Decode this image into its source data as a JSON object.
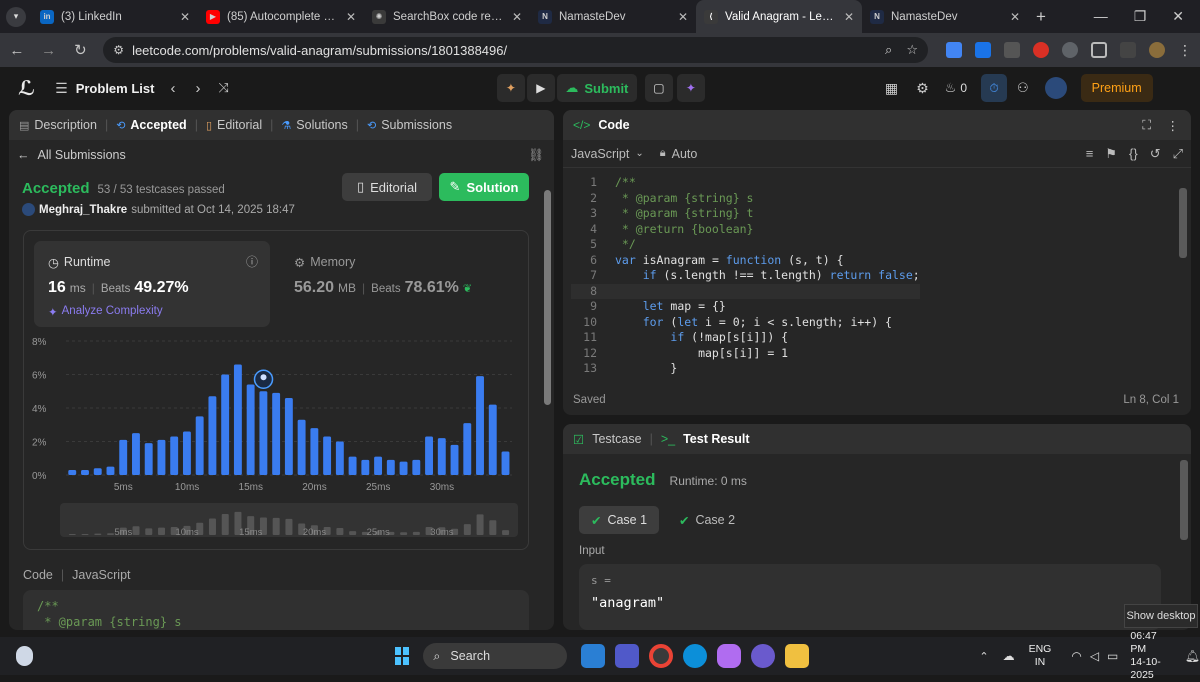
{
  "browser": {
    "tabs": [
      {
        "title": "(3) LinkedIn",
        "icon": "linkedin-icon",
        "color": "#0a66c2",
        "glyph": "in"
      },
      {
        "title": "(85) Autocomplete Search",
        "icon": "youtube-icon",
        "color": "#ff0000",
        "glyph": "▶"
      },
      {
        "title": "SearchBox code review",
        "icon": "chatgpt-icon",
        "color": "#3a3a3a",
        "glyph": "✺"
      },
      {
        "title": "NamasteDev",
        "icon": "namastedev-icon",
        "color": "#1f2a44",
        "glyph": "N"
      },
      {
        "title": "Valid Anagram - LeetCode",
        "icon": "leetcode-icon",
        "color": "#3a3a3a",
        "glyph": "⟨"
      },
      {
        "title": "NamasteDev",
        "icon": "namastedev-icon",
        "color": "#1f2a44",
        "glyph": "N"
      }
    ],
    "active_tab": 4,
    "new_tab": "+",
    "url": "leetcode.com/problems/valid-anagram/submissions/1801388496/"
  },
  "leetcode": {
    "problem_list": "Problem List",
    "submit_label": "Submit",
    "streak_count": "0",
    "premium_label": "Premium"
  },
  "left_panel": {
    "tabs": [
      "Description",
      "Accepted",
      "Editorial",
      "Solutions",
      "Submissions"
    ],
    "active_tab": "Accepted",
    "all_submissions": "All Submissions",
    "status": "Accepted",
    "testcases": "53 / 53 testcases passed",
    "user": "Meghraj_Thakre",
    "submitted_at": "submitted at Oct 14, 2025 18:47",
    "editorial_btn": "Editorial",
    "solution_btn": "Solution",
    "runtime_label": "Runtime",
    "runtime_value": "16",
    "runtime_unit": "ms",
    "runtime_beats_label": "Beats",
    "runtime_beats": "49.27%",
    "analyze": "Analyze Complexity",
    "memory_label": "Memory",
    "memory_value": "56.20",
    "memory_unit": "MB",
    "memory_beats_label": "Beats",
    "memory_beats": "78.61%",
    "code_label": "Code",
    "code_lang": "JavaScript",
    "code_preview": [
      "/**",
      " * @param {string} s"
    ]
  },
  "chart_data": {
    "type": "bar",
    "ylabels": [
      "8%",
      "6%",
      "4%",
      "2%",
      "0%"
    ],
    "ylim": [
      0,
      8
    ],
    "xlabels": [
      "5ms",
      "10ms",
      "15ms",
      "20ms",
      "25ms",
      "30ms"
    ],
    "xlabel_positions": [
      5,
      10,
      15,
      20,
      25,
      30
    ],
    "x": [
      1,
      2,
      3,
      4,
      5,
      6,
      7,
      8,
      9,
      10,
      11,
      12,
      13,
      14,
      15,
      16,
      17,
      18,
      18.8,
      19.8,
      20.8,
      21.8,
      22.8,
      23.8,
      24.8,
      25.8,
      26.8,
      27.8,
      28.8,
      29.8,
      30.8,
      31.8
    ],
    "values": [
      0.3,
      0.3,
      0.4,
      0.5,
      2.1,
      2.5,
      1.9,
      2.1,
      2.3,
      2.6,
      3.5,
      4.7,
      6.0,
      6.6,
      5.4,
      5.0,
      4.9,
      4.6,
      3.3,
      2.8,
      2.3,
      2.0,
      1.1,
      0.9,
      1.1,
      0.9,
      0.8,
      0.9,
      2.3,
      2.2,
      1.8,
      3.1,
      5.9,
      4.2,
      1.4
    ],
    "user_runtime_ms": 16,
    "bar_color": "#3a7cf0"
  },
  "right_panel": {
    "code_tab": "Code",
    "language": "JavaScript",
    "mode": "Auto",
    "saved": "Saved",
    "cursor": "Ln 8, Col 1",
    "code_lines": [
      "/**",
      " * @param {string} s",
      " * @param {string} t",
      " * @return {boolean}",
      " */",
      "var isAnagram = function (s, t) {",
      "    if (s.length !== t.length) return false;",
      "",
      "    let map = {}",
      "    for (let i = 0; i < s.length; i++) {",
      "        if (!map[s[i]]) {",
      "            map[s[i]] = 1",
      "        }"
    ],
    "testcase_tab": "Testcase",
    "result_tab": "Test Result",
    "result_status": "Accepted",
    "result_runtime": "Runtime: 0 ms",
    "cases": [
      "Case 1",
      "Case 2"
    ],
    "input_label": "Input",
    "input_var": "s =",
    "input_value": "\"anagram\""
  },
  "taskbar": {
    "search": "Search",
    "lang_top": "ENG",
    "lang_bottom": "IN",
    "time": "06:47 PM",
    "date": "14-10-2025",
    "show_desktop": "Show desktop"
  }
}
